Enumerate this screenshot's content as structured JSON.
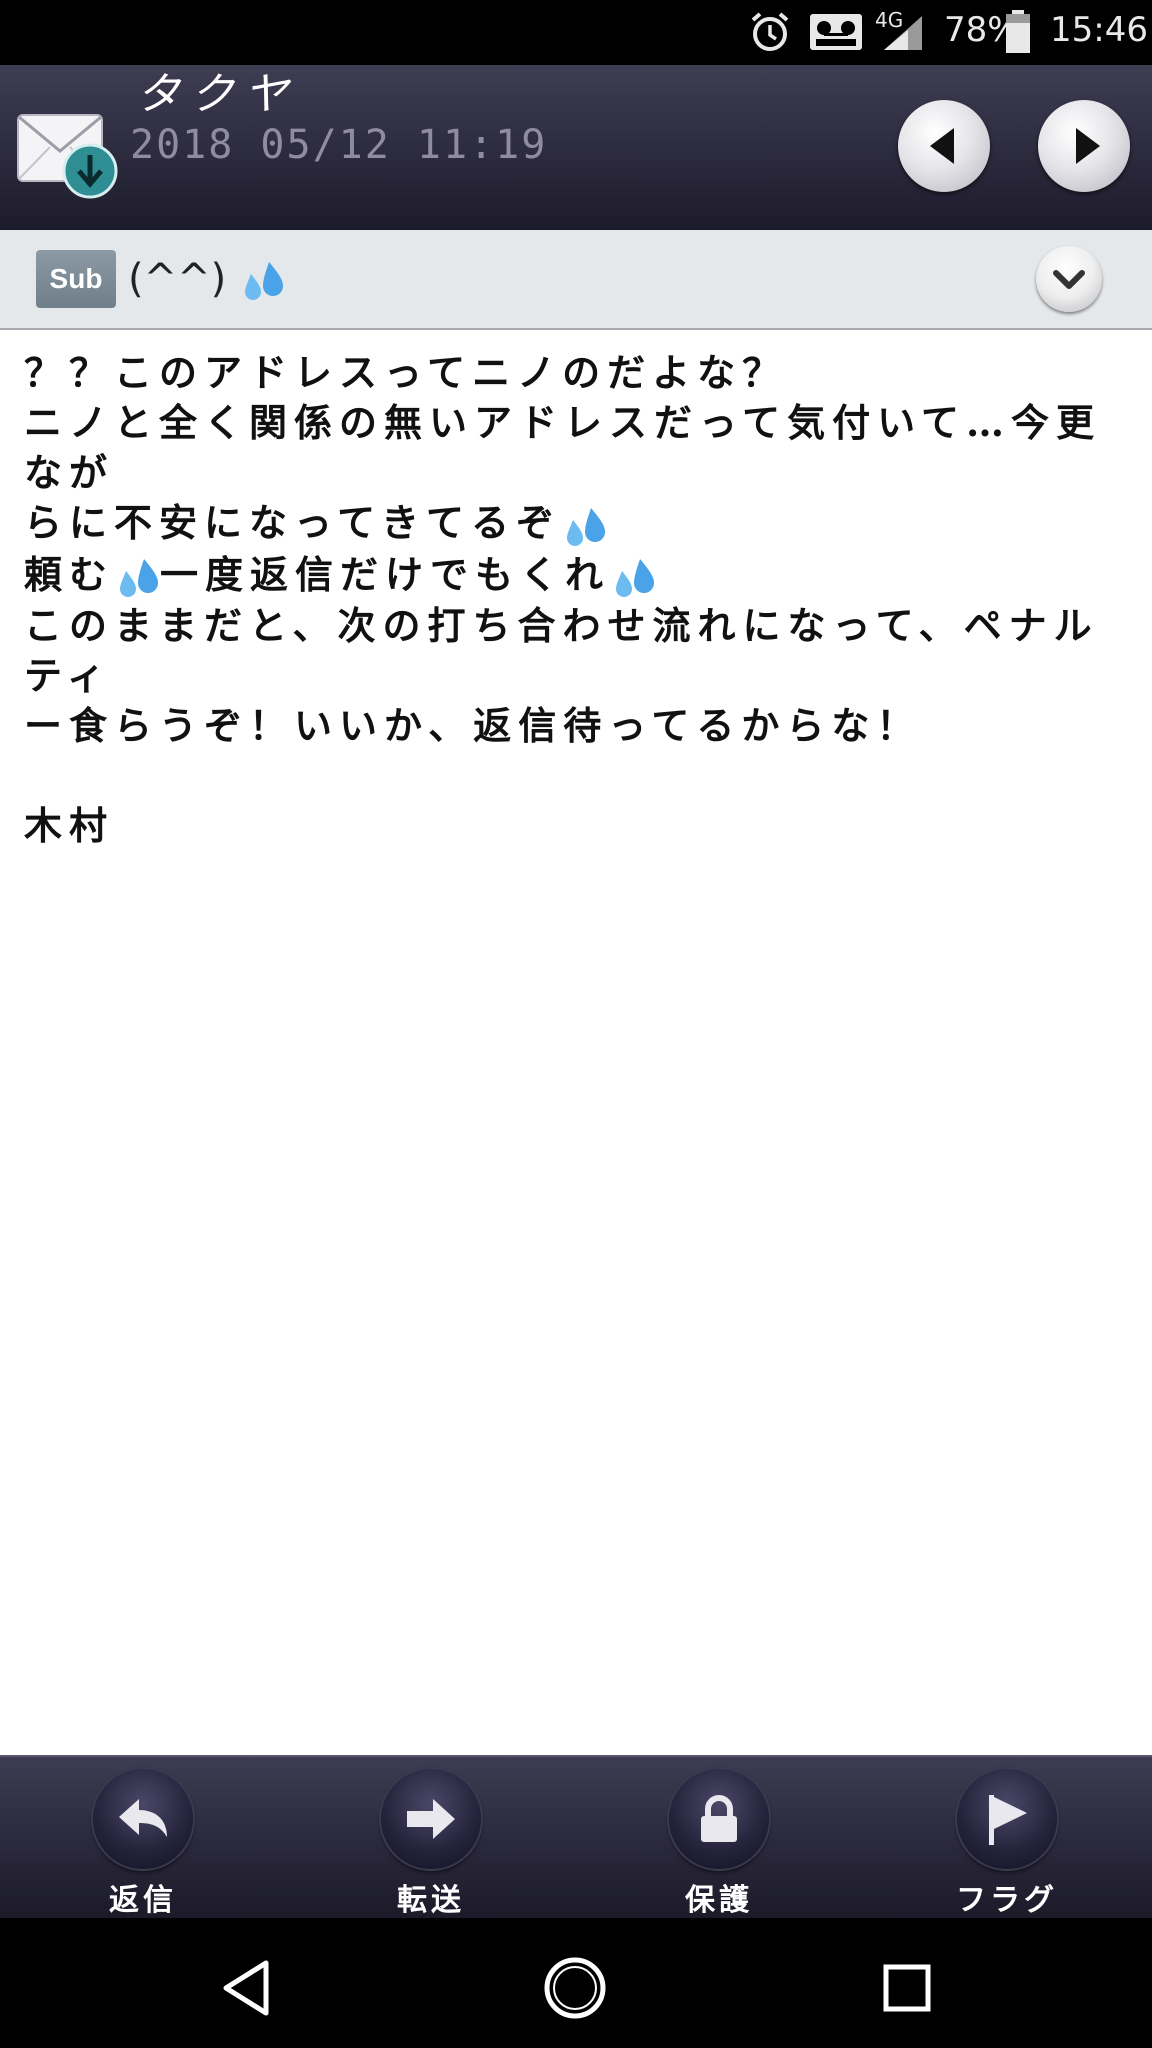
{
  "status_bar": {
    "network": "4G",
    "battery": "78%",
    "time": "15:46",
    "icons": [
      "alarm-clock-icon",
      "voicemail-icon",
      "signal-icon",
      "battery-icon"
    ]
  },
  "header": {
    "sender": "タクヤ",
    "datetime": "2018 05/12 11:19",
    "icons": [
      "received-mail-icon",
      "previous-icon",
      "next-icon"
    ]
  },
  "subject": {
    "badge": "Sub",
    "text": "(^^)"
  },
  "body": {
    "line1": "？？このアドレスってニノのだよな？",
    "line2a": "ニノと全く関係の無いアドレスだって気付いて…今更なが",
    "line2b": "らに不安になってきてるぞ",
    "line3a": "頼む",
    "line3b": "一度返信だけでもくれ",
    "line4a": "このままだと、次の打ち合わせ流れになって、ペナルティ",
    "line4b": "ー食らうぞ！いいか、返信待ってるからな！",
    "signature": "木村"
  },
  "toolbar": {
    "reply": "返信",
    "forward": "転送",
    "protect": "保護",
    "flag": "フラグ"
  },
  "colors": {
    "header_bg": "#2c2a3d",
    "subject_bg": "#e4e8ea",
    "badge_bg": "#7b8b96",
    "sweat_drop": "#4aa3e8"
  }
}
